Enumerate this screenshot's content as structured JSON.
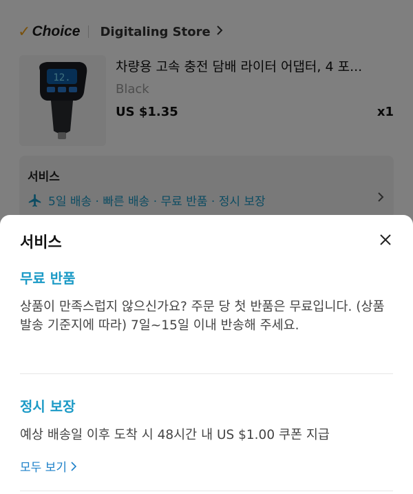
{
  "store": {
    "choice_label": "Choice",
    "name": "Digitaling Store"
  },
  "product": {
    "title": "차량용 고속 충전 담배 라이터 어댑터, 4 포...",
    "variant": "Black",
    "price": "US $1.35",
    "quantity": "x1"
  },
  "service_card": {
    "title": "서비스",
    "summary": "5일 배송 · 빠른 배송 · 무료 반품 · 정시 보장"
  },
  "sheet": {
    "title": "서비스",
    "sections": [
      {
        "title": "무료 반품",
        "body": "상품이 만족스럽지 않으신가요? 주문 당 첫 반품은 무료입니다. (상품 발송 기준지에 따라) 7일~15일 이내 반송해 주세요."
      },
      {
        "title": "정시 보장",
        "body": "예상 배송일 이후 도착 시 48시간 내 US $1.00 쿠폰 지급",
        "link": "모두 보기"
      }
    ]
  },
  "colors": {
    "accent": "#1b9ac6",
    "link": "#1a7fc8",
    "choice_check": "#f2a31b",
    "overlay": "rgba(0,0,0,0.5)"
  },
  "icons": [
    "choice-check-icon",
    "chevron-right-icon",
    "airplane-icon",
    "close-icon"
  ]
}
